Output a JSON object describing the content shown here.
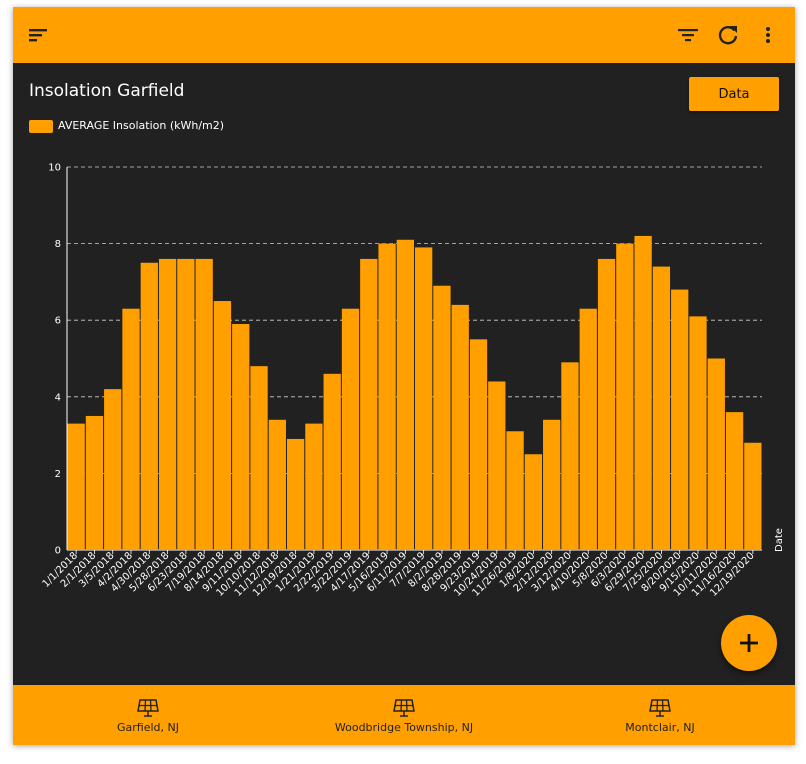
{
  "toolbar": {
    "menu_icon": "sort-menu-icon",
    "filter_icon": "filter-icon",
    "refresh_icon": "refresh-icon",
    "more_icon": "more-vert-icon",
    "color": "#ffa000"
  },
  "main": {
    "title": "Insolation Garfield",
    "data_button_label": "Data",
    "fab_icon": "add-icon"
  },
  "chart_data": {
    "type": "bar",
    "title": "Insolation Garfield",
    "xlabel": "Date",
    "ylabel": "",
    "ylim": [
      0,
      10
    ],
    "yticks": [
      "0",
      "2",
      "4",
      "6",
      "8",
      "10"
    ],
    "grid": true,
    "legend_position": "top-left",
    "series_color": "#ffa000",
    "x_start": "1/1/2018",
    "x_end": "12/31/2020",
    "categories": [
      "1/1/2018",
      "2/1/2018",
      "3/5/2018",
      "4/2/2018",
      "4/30/2018",
      "5/28/2018",
      "6/23/2018",
      "7/19/2018",
      "8/14/2018",
      "9/11/2018",
      "10/10/2018",
      "11/12/2018",
      "12/19/2018",
      "1/21/2019",
      "2/22/2019",
      "3/22/2019",
      "4/17/2019",
      "5/16/2019",
      "6/11/2019",
      "7/7/2019",
      "8/2/2019",
      "8/28/2019",
      "9/23/2019",
      "10/24/2019",
      "11/26/2019",
      "1/8/2020",
      "2/12/2020",
      "3/12/2020",
      "4/10/2020",
      "5/8/2020",
      "6/3/2020",
      "6/29/2020",
      "7/25/2020",
      "8/20/2020",
      "9/15/2020",
      "10/11/2020",
      "11/16/2020",
      "12/19/2020"
    ],
    "series": [
      {
        "name": "AVERAGE Insolation (kWh/m2)",
        "values": [
          3.3,
          3.5,
          4.2,
          6.3,
          7.5,
          7.6,
          7.6,
          7.6,
          6.5,
          5.9,
          4.8,
          3.4,
          2.9,
          3.3,
          4.6,
          6.3,
          7.6,
          8.0,
          8.1,
          7.9,
          6.9,
          6.4,
          5.5,
          4.4,
          3.1,
          2.5,
          3.4,
          4.9,
          6.3,
          7.6,
          8.0,
          8.2,
          7.4,
          6.8,
          6.1,
          5.0,
          3.6,
          2.8
        ]
      }
    ]
  },
  "bottom_nav": {
    "items": [
      {
        "label": "Garfield, NJ",
        "icon": "solar-panel-icon"
      },
      {
        "label": "Woodbridge Township, NJ",
        "icon": "solar-panel-icon"
      },
      {
        "label": "Montclair, NJ",
        "icon": "solar-panel-icon"
      }
    ]
  }
}
